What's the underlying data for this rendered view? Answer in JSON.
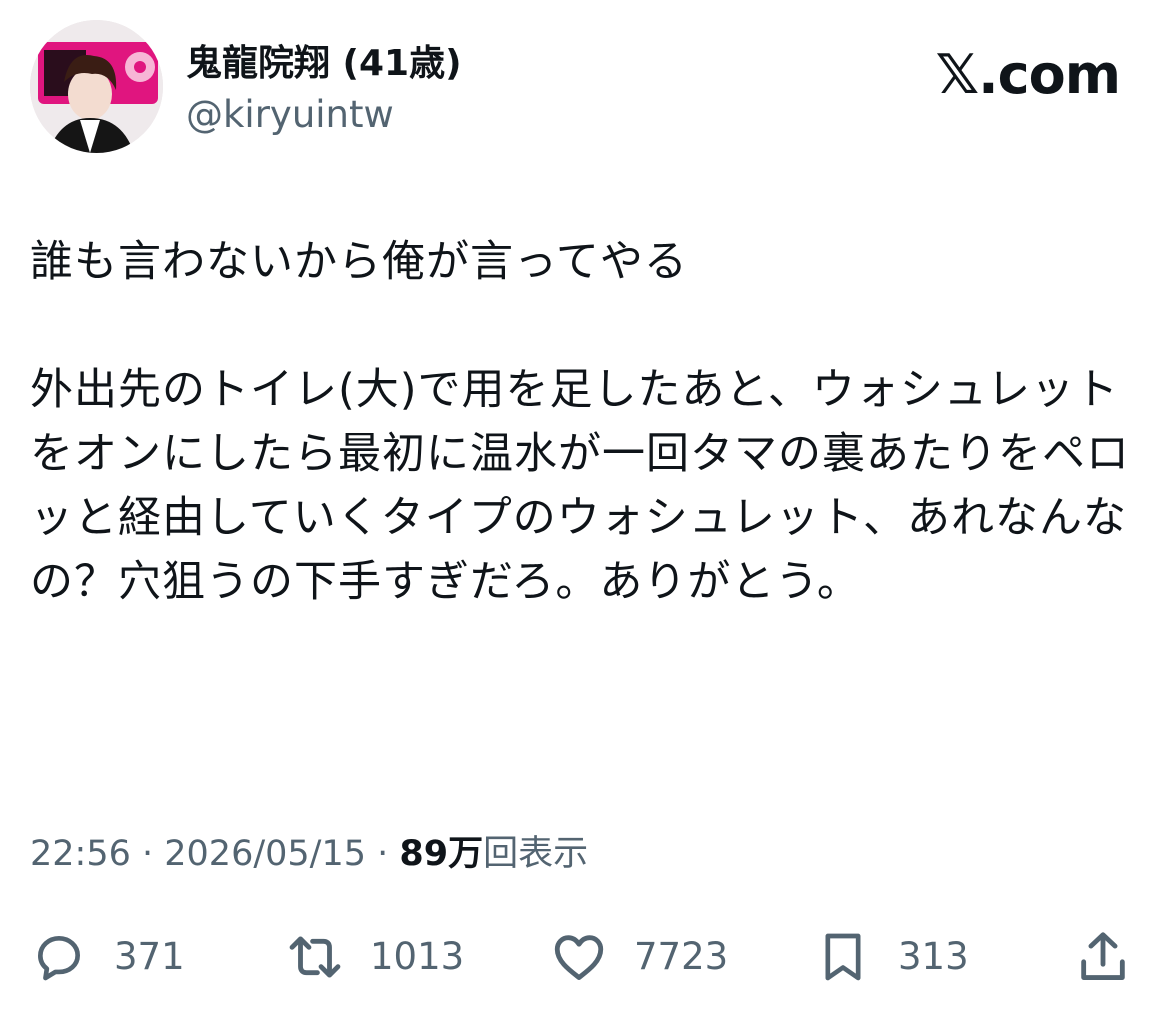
{
  "header": {
    "display_name": "鬼龍院翔 (41歳)",
    "handle": "@kiryuintw",
    "site_logo": "𝕏.com"
  },
  "tweet": {
    "text": "誰も言わないから俺が言ってやる\n\n外出先のトイレ(大)で用を足したあと、ウォシュレットをオンにしたら最初に温水が一回タマの裏あたりをペロッと経由していくタイプのウォシュレット、あれなんなの？穴狙うの下手すぎだろ。ありがとう。",
    "time": "22:56",
    "date": "2026/05/15",
    "separator": " · ",
    "views_count": "89万",
    "views_label": "回表示"
  },
  "actions": {
    "reply": {
      "icon": "reply-icon",
      "count": "371"
    },
    "retweet": {
      "icon": "retweet-icon",
      "count": "1013"
    },
    "like": {
      "icon": "heart-icon",
      "count": "7723"
    },
    "bookmark": {
      "icon": "bookmark-icon",
      "count": "313"
    },
    "share": {
      "icon": "share-icon"
    }
  },
  "colors": {
    "text_primary": "#0f1419",
    "text_secondary": "#536471",
    "avatar_accent": "#e0157f"
  }
}
